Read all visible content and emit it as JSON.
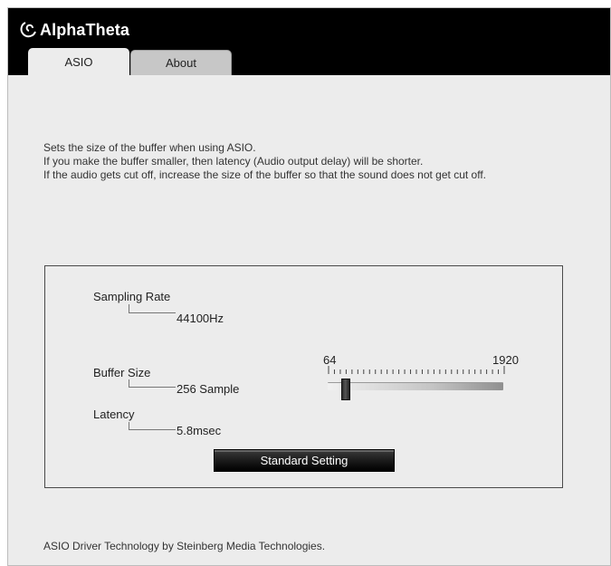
{
  "app": {
    "logo_text": "AlphaTheta"
  },
  "tabs": [
    {
      "label": "ASIO",
      "active": true
    },
    {
      "label": "About",
      "active": false
    }
  ],
  "description": {
    "line1": "Sets the size of the buffer when using ASIO.",
    "line2": "If you make the buffer smaller, then latency (Audio output delay) will be shorter.",
    "line3": "If the audio gets cut off, increase the size of the buffer so that the sound does not get cut off."
  },
  "settings": {
    "sampling_rate_label": "Sampling Rate",
    "sampling_rate_value": "44100Hz",
    "buffer_size_label": "Buffer Size",
    "buffer_size_value": "256 Sample",
    "latency_label": "Latency",
    "latency_value": "5.8msec"
  },
  "slider": {
    "min_label": "64",
    "max_label": "1920",
    "min": 64,
    "max": 1920,
    "value": 256
  },
  "standard_button_label": "Standard Setting",
  "footer": "ASIO Driver Technology by Steinberg Media Technologies.",
  "colors": {
    "titlebar": "#000000",
    "background": "#ececec",
    "button": "#1a1a1a"
  }
}
